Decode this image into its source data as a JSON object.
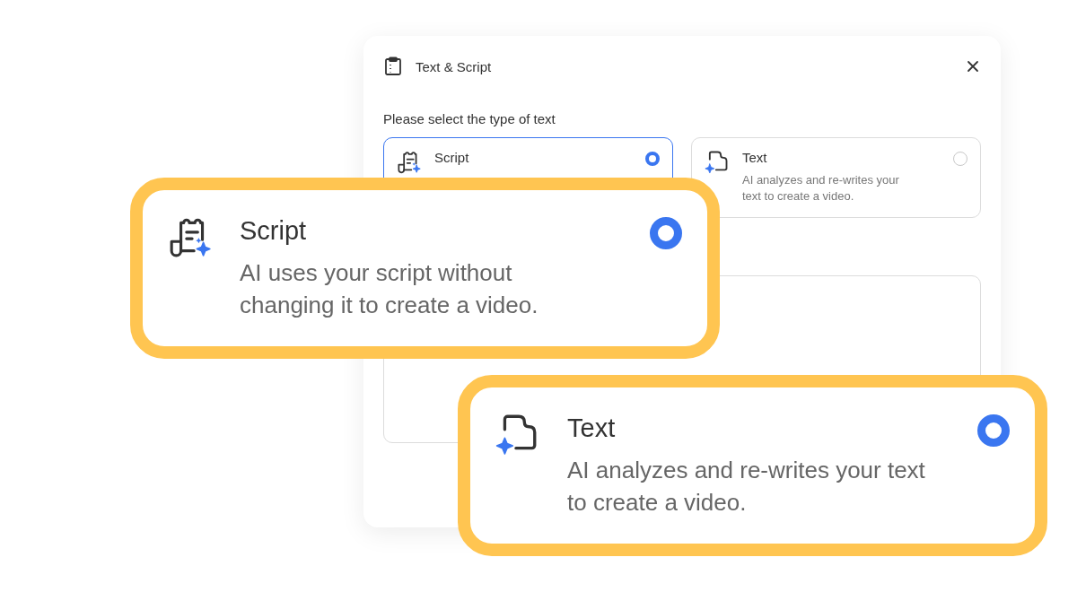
{
  "dialog": {
    "title": "Text & Script",
    "prompt": "Please select the type of text",
    "cards": [
      {
        "kind": "script",
        "title": "Script",
        "selected": true
      },
      {
        "kind": "text",
        "title": "Text",
        "description": "AI analyzes and re-writes your text to create a video.",
        "selected": false
      }
    ]
  },
  "callouts": [
    {
      "kind": "script",
      "title": "Script",
      "description": "AI uses your script without changing it to create a video.",
      "selected": true
    },
    {
      "kind": "text",
      "title": "Text",
      "description": "AI analyzes and re-writes your text to create a video.",
      "selected": true
    }
  ]
}
